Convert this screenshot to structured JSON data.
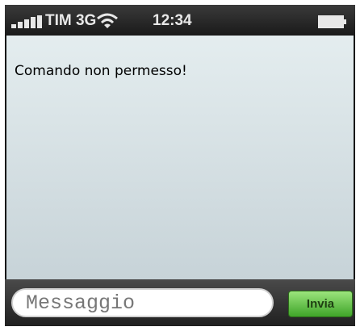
{
  "status_bar": {
    "carrier": "TIM 3G",
    "time": "12:34",
    "signal_icon": "signal-bars-icon",
    "wifi_icon": "wifi-icon",
    "battery_icon": "battery-icon"
  },
  "chat": {
    "message": "Comando non permesso!"
  },
  "composer": {
    "placeholder": "Messaggio",
    "send_label": "Invia",
    "send_color": "#5cbf3c"
  }
}
